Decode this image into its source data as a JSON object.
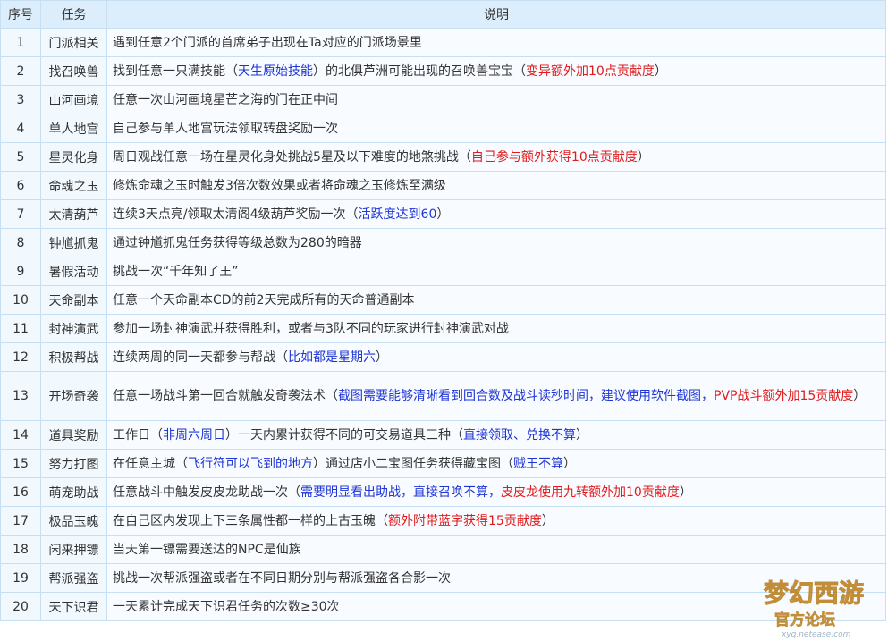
{
  "columns": {
    "num": "序号",
    "task": "任务",
    "desc": "说明"
  },
  "rows": [
    {
      "num": "1",
      "task": "门派相关",
      "desc": [
        {
          "text": "遇到任意2个门派的首席弟子出现在Ta对应的门派场景里",
          "color": "normal"
        }
      ]
    },
    {
      "num": "2",
      "task": "找召唤兽",
      "desc": [
        {
          "text": "找到任意一只满技能（",
          "color": "normal"
        },
        {
          "text": "天生原始技能",
          "color": "blue"
        },
        {
          "text": "）的北俱芦洲可能出现的召唤兽宝宝（",
          "color": "normal"
        },
        {
          "text": "变异额外加10点贡献度",
          "color": "red"
        },
        {
          "text": "）",
          "color": "normal"
        }
      ]
    },
    {
      "num": "3",
      "task": "山河画境",
      "desc": [
        {
          "text": "任意一次山河画境星芒之海的门在正中间",
          "color": "normal"
        }
      ]
    },
    {
      "num": "4",
      "task": "单人地宫",
      "desc": [
        {
          "text": "自己参与单人地宫玩法领取转盘奖励一次",
          "color": "normal"
        }
      ]
    },
    {
      "num": "5",
      "task": "星灵化身",
      "desc": [
        {
          "text": "周日观战任意一场在星灵化身处挑战5星及以下难度的地煞挑战（",
          "color": "normal"
        },
        {
          "text": "自己参与额外获得10点贡献度",
          "color": "red"
        },
        {
          "text": "）",
          "color": "normal"
        }
      ]
    },
    {
      "num": "6",
      "task": "命魂之玉",
      "desc": [
        {
          "text": "修炼命魂之玉时触发3倍次数效果或者将命魂之玉修炼至满级",
          "color": "normal"
        }
      ]
    },
    {
      "num": "7",
      "task": "太清葫芦",
      "desc": [
        {
          "text": "连续3天点亮/领取太清阁4级葫芦奖励一次（",
          "color": "normal"
        },
        {
          "text": "活跃度达到60",
          "color": "blue"
        },
        {
          "text": "）",
          "color": "normal"
        }
      ]
    },
    {
      "num": "8",
      "task": "钟馗抓鬼",
      "desc": [
        {
          "text": "通过钟馗抓鬼任务获得等级总数为280的暗器",
          "color": "normal"
        }
      ]
    },
    {
      "num": "9",
      "task": "暑假活动",
      "desc": [
        {
          "text": "挑战一次“千年知了王”",
          "color": "normal"
        }
      ]
    },
    {
      "num": "10",
      "task": "天命副本",
      "desc": [
        {
          "text": "任意一个天命副本CD的前2天完成所有的天命普通副本",
          "color": "normal"
        }
      ]
    },
    {
      "num": "11",
      "task": "封神演武",
      "desc": [
        {
          "text": "参加一场封神演武并获得胜利，或者与3队不同的玩家进行封神演武对战",
          "color": "normal"
        }
      ]
    },
    {
      "num": "12",
      "task": "积极帮战",
      "desc": [
        {
          "text": "连续两周的同一天都参与帮战（",
          "color": "normal"
        },
        {
          "text": "比如都是星期六",
          "color": "blue"
        },
        {
          "text": "）",
          "color": "normal"
        }
      ]
    },
    {
      "num": "13",
      "task": "开场奇袭",
      "tall": true,
      "desc": [
        {
          "text": "任意一场战斗第一回合就触发奇袭法术（",
          "color": "normal"
        },
        {
          "text": "截图需要能够清晰看到回合数及战斗读秒时间，建议使用软件截图，",
          "color": "blue"
        },
        {
          "text": "PVP战斗额外加15贡献度",
          "color": "red"
        },
        {
          "text": "）",
          "color": "normal"
        }
      ]
    },
    {
      "num": "14",
      "task": "道具奖励",
      "desc": [
        {
          "text": "工作日（",
          "color": "normal"
        },
        {
          "text": "非周六周日",
          "color": "blue"
        },
        {
          "text": "）一天内累计获得不同的可交易道具三种（",
          "color": "normal"
        },
        {
          "text": "直接领取、兑换不算",
          "color": "blue"
        },
        {
          "text": "）",
          "color": "normal"
        }
      ]
    },
    {
      "num": "15",
      "task": "努力打图",
      "desc": [
        {
          "text": "在任意主城（",
          "color": "normal"
        },
        {
          "text": "飞行符可以飞到的地方",
          "color": "blue"
        },
        {
          "text": "）通过店小二宝图任务获得藏宝图（",
          "color": "normal"
        },
        {
          "text": "贼王不算",
          "color": "blue"
        },
        {
          "text": "）",
          "color": "normal"
        }
      ]
    },
    {
      "num": "16",
      "task": "萌宠助战",
      "desc": [
        {
          "text": "任意战斗中触发皮皮龙助战一次（",
          "color": "normal"
        },
        {
          "text": "需要明显看出助战，直接召唤不算，",
          "color": "blue"
        },
        {
          "text": "皮皮龙使用九转额外加10贡献度",
          "color": "red"
        },
        {
          "text": "）",
          "color": "normal"
        }
      ]
    },
    {
      "num": "17",
      "task": "极品玉魄",
      "desc": [
        {
          "text": "在自己区内发现上下三条属性都一样的上古玉魄（",
          "color": "normal"
        },
        {
          "text": "额外附带蓝字获得15贡献度",
          "color": "red"
        },
        {
          "text": "）",
          "color": "normal"
        }
      ]
    },
    {
      "num": "18",
      "task": "闲来押镖",
      "desc": [
        {
          "text": "当天第一镖需要送达的NPC是仙族",
          "color": "normal"
        }
      ]
    },
    {
      "num": "19",
      "task": "帮派强盗",
      "desc": [
        {
          "text": "挑战一次帮派强盗或者在不同日期分别与帮派强盗各合影一次",
          "color": "normal"
        }
      ]
    },
    {
      "num": "20",
      "task": "天下识君",
      "desc": [
        {
          "text": "一天累计完成天下识君任务的次数≥30次",
          "color": "normal"
        }
      ]
    }
  ],
  "watermark": {
    "title": "梦幻西游",
    "subtitle": "官方论坛",
    "url": "xyq.netease.com"
  },
  "colors": {
    "header_bg": "#dcedfb",
    "cell_bg": "#f1f8fe",
    "border": "#c6dff3",
    "blue": "#1e35d6",
    "red": "#e01b1b"
  }
}
